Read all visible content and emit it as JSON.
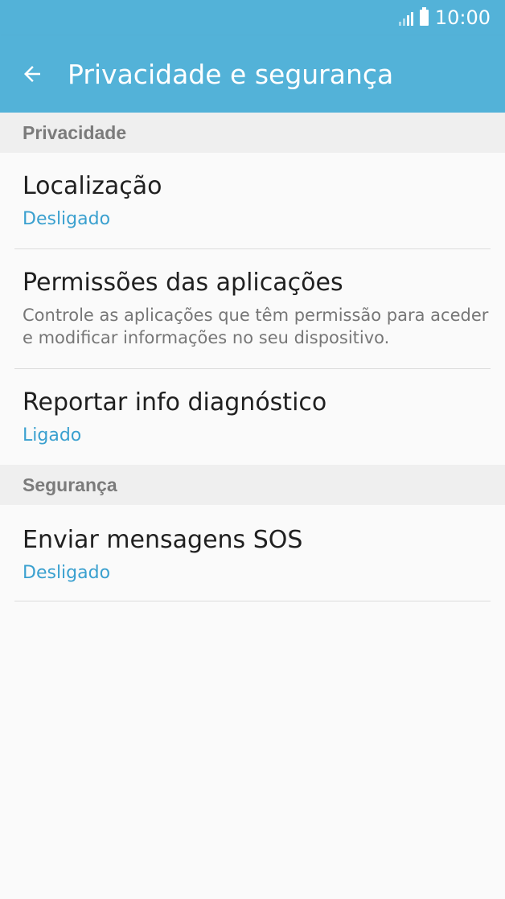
{
  "status_bar": {
    "time": "10:00",
    "icons": [
      "signal-icon",
      "battery-icon"
    ]
  },
  "app_bar": {
    "back_icon": "arrow-left-icon",
    "title": "Privacidade e segurança",
    "background_color": "#53b2d8"
  },
  "sections": [
    {
      "header": "Privacidade",
      "items": [
        {
          "title": "Localização",
          "subtitle": "Desligado"
        },
        {
          "title": "Permissões das aplicações",
          "description": "Controle as aplicações que têm permissão para aceder e modificar informações no seu dispositivo."
        },
        {
          "title": "Reportar info diagnóstico",
          "subtitle": "Ligado"
        }
      ]
    },
    {
      "header": "Segurança",
      "items": [
        {
          "title": "Enviar mensagens SOS",
          "subtitle": "Desligado"
        }
      ]
    }
  ],
  "colors": {
    "accent": "#3aa0cf",
    "section_header_bg": "#efefef",
    "background": "#fafafa"
  }
}
